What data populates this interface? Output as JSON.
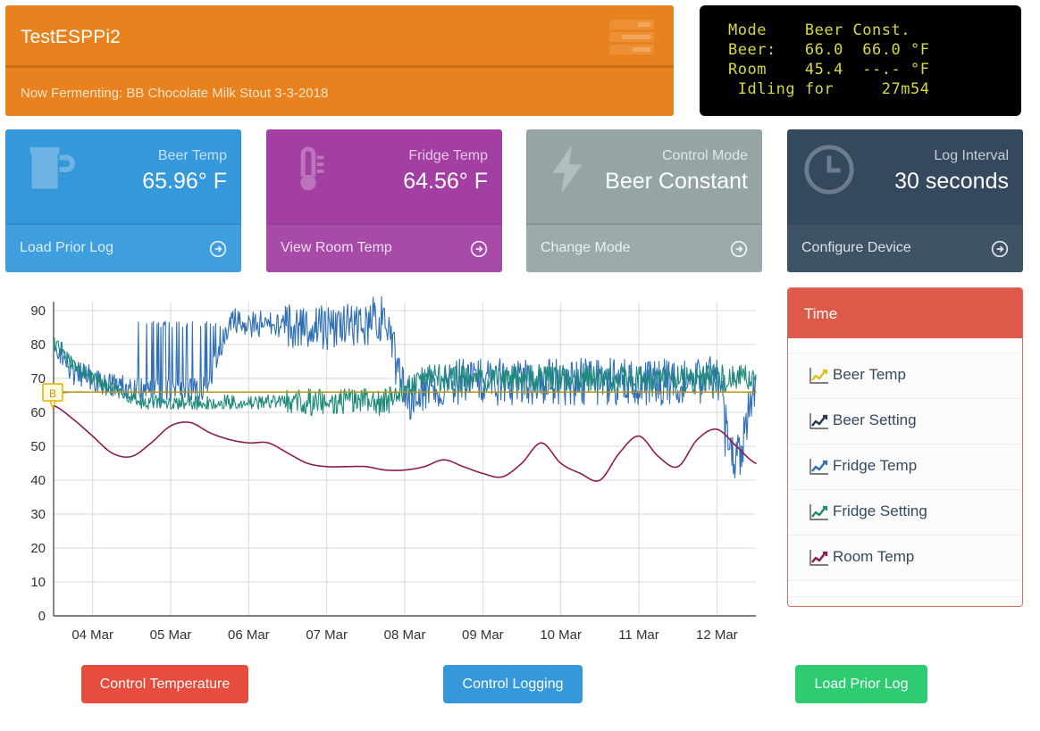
{
  "header": {
    "title": "TestESPPi2",
    "fermenting_text": "Now Fermenting: BB Chocolate Milk Stout 3-3-2018",
    "menu_icon": "server-stack-icon",
    "bg_color": "#e8821e"
  },
  "lcd": {
    "line1": "Mode    Beer Const.",
    "line2": "Beer:   66.0  66.0 °F",
    "line3": "Room    45.4  --.- °F",
    "line4": " Idling for     27m54",
    "text_color": "#d8d83c",
    "bg_color": "#000000"
  },
  "cards": [
    {
      "label": "Beer Temp",
      "value": "65.96° F",
      "action": "Load Prior Log",
      "icon": "beer-mug-icon",
      "color": "#3498db"
    },
    {
      "label": "Fridge Temp",
      "value": "64.56° F",
      "action": "View Room Temp",
      "icon": "thermometer-icon",
      "color": "#a33fa3"
    },
    {
      "label": "Control Mode",
      "value": "Beer Constant",
      "action": "Change Mode",
      "icon": "lightning-bolt-icon",
      "color": "#95a5a6"
    },
    {
      "label": "Log Interval",
      "value": "30 seconds",
      "action": "Configure Device",
      "icon": "clock-icon",
      "color": "#34495e"
    }
  ],
  "legend": {
    "title": "Time",
    "header_color": "#dd5a4b",
    "items": [
      {
        "label": "Beer Temp",
        "color": "#e3c020",
        "icon": "line-chart-icon"
      },
      {
        "label": "Beer Setting",
        "color": "#223a52",
        "icon": "line-chart-icon"
      },
      {
        "label": "Fridge Temp",
        "color": "#2f6fb5",
        "icon": "line-chart-icon"
      },
      {
        "label": "Fridge Setting",
        "color": "#1f8a7a",
        "icon": "line-chart-icon"
      },
      {
        "label": "Room Temp",
        "color": "#8e1b52",
        "icon": "line-chart-icon"
      }
    ]
  },
  "buttons": [
    {
      "label": "Control Temperature",
      "color": "#e74c3c"
    },
    {
      "label": "Control Logging",
      "color": "#3498db"
    },
    {
      "label": "Load Prior Log",
      "color": "#2ecc71"
    }
  ],
  "chart_data": {
    "type": "line",
    "title": "",
    "xlabel": "",
    "ylabel": "",
    "ylim": [
      0,
      90
    ],
    "yticks": [
      0,
      10,
      20,
      30,
      40,
      50,
      60,
      70,
      80,
      90
    ],
    "xticks": [
      "04 Mar",
      "05 Mar",
      "06 Mar",
      "07 Mar",
      "08 Mar",
      "09 Mar",
      "10 Mar",
      "11 Mar",
      "12 Mar"
    ],
    "grid": true,
    "legend_position": "right-panel",
    "annotation": {
      "label": "B",
      "value": 65.5,
      "x_index": 0,
      "color": "#e3c020"
    },
    "series": [
      {
        "name": "Beer Temp",
        "color": "#b8960f",
        "note": "near-flat line at setpoint",
        "values": [
          65.5,
          66.0,
          66.0,
          66.0,
          66.0,
          66.0,
          66.0,
          66.0,
          66.0,
          66.0,
          66.0,
          66.0,
          66.0,
          66.0,
          66.0,
          66.0,
          66.0,
          66.0,
          66.0,
          66.0,
          66.0,
          66.0,
          66.0,
          66.0,
          66.0,
          66.0,
          66.0,
          66.0,
          66.0,
          66.0,
          66.0,
          66.0,
          66.0,
          66.0,
          66.0,
          66.0,
          65.96
        ]
      },
      {
        "name": "Beer Setting",
        "color": "#7a6a14",
        "note": "constant setpoint",
        "values": [
          66.0,
          66.0,
          66.0,
          66.0,
          66.0,
          66.0,
          66.0,
          66.0,
          66.0,
          66.0,
          66.0,
          66.0,
          66.0,
          66.0,
          66.0,
          66.0,
          66.0,
          66.0,
          66.0,
          66.0,
          66.0,
          66.0,
          66.0,
          66.0,
          66.0,
          66.0,
          66.0,
          66.0,
          66.0,
          66.0,
          66.0,
          66.0,
          66.0,
          66.0,
          66.0,
          66.0,
          66.0
        ]
      },
      {
        "name": "Fridge Temp",
        "color": "#2f6fb5",
        "note": "heavily oscillating, spikes to ~86 between 05 Mar and 06 Mar, dip to ~47 near 12 Mar",
        "values": [
          80,
          72,
          70,
          68,
          67,
          66,
          66,
          66,
          70,
          86,
          86,
          86,
          85,
          85,
          85,
          85,
          86,
          86,
          66,
          67,
          68,
          69,
          69,
          69,
          69,
          69,
          69,
          69,
          69,
          69,
          69,
          69,
          69,
          69,
          69,
          47,
          68
        ]
      },
      {
        "name": "Fridge Setting",
        "color": "#1f8a7a",
        "note": "oscillating around 63-70",
        "values": [
          80,
          74,
          70,
          67,
          64,
          63,
          63,
          63,
          63,
          63,
          63,
          63,
          63,
          63,
          63,
          63,
          63,
          63,
          66,
          70,
          70,
          70,
          70,
          70,
          70,
          70,
          70,
          70,
          70,
          70,
          70,
          70,
          70,
          70,
          70,
          70,
          70
        ]
      },
      {
        "name": "Room Temp",
        "color": "#8e1b52",
        "note": "smooth diurnal wave declining then cycling",
        "values": [
          62,
          58,
          53,
          48,
          47,
          51,
          56,
          57,
          54,
          52,
          51,
          51,
          48,
          45,
          44,
          44,
          44,
          43,
          43,
          44,
          46,
          44,
          42,
          41,
          45,
          51,
          45,
          42,
          40,
          48,
          53,
          47,
          44,
          52,
          55,
          50,
          45
        ]
      }
    ]
  }
}
